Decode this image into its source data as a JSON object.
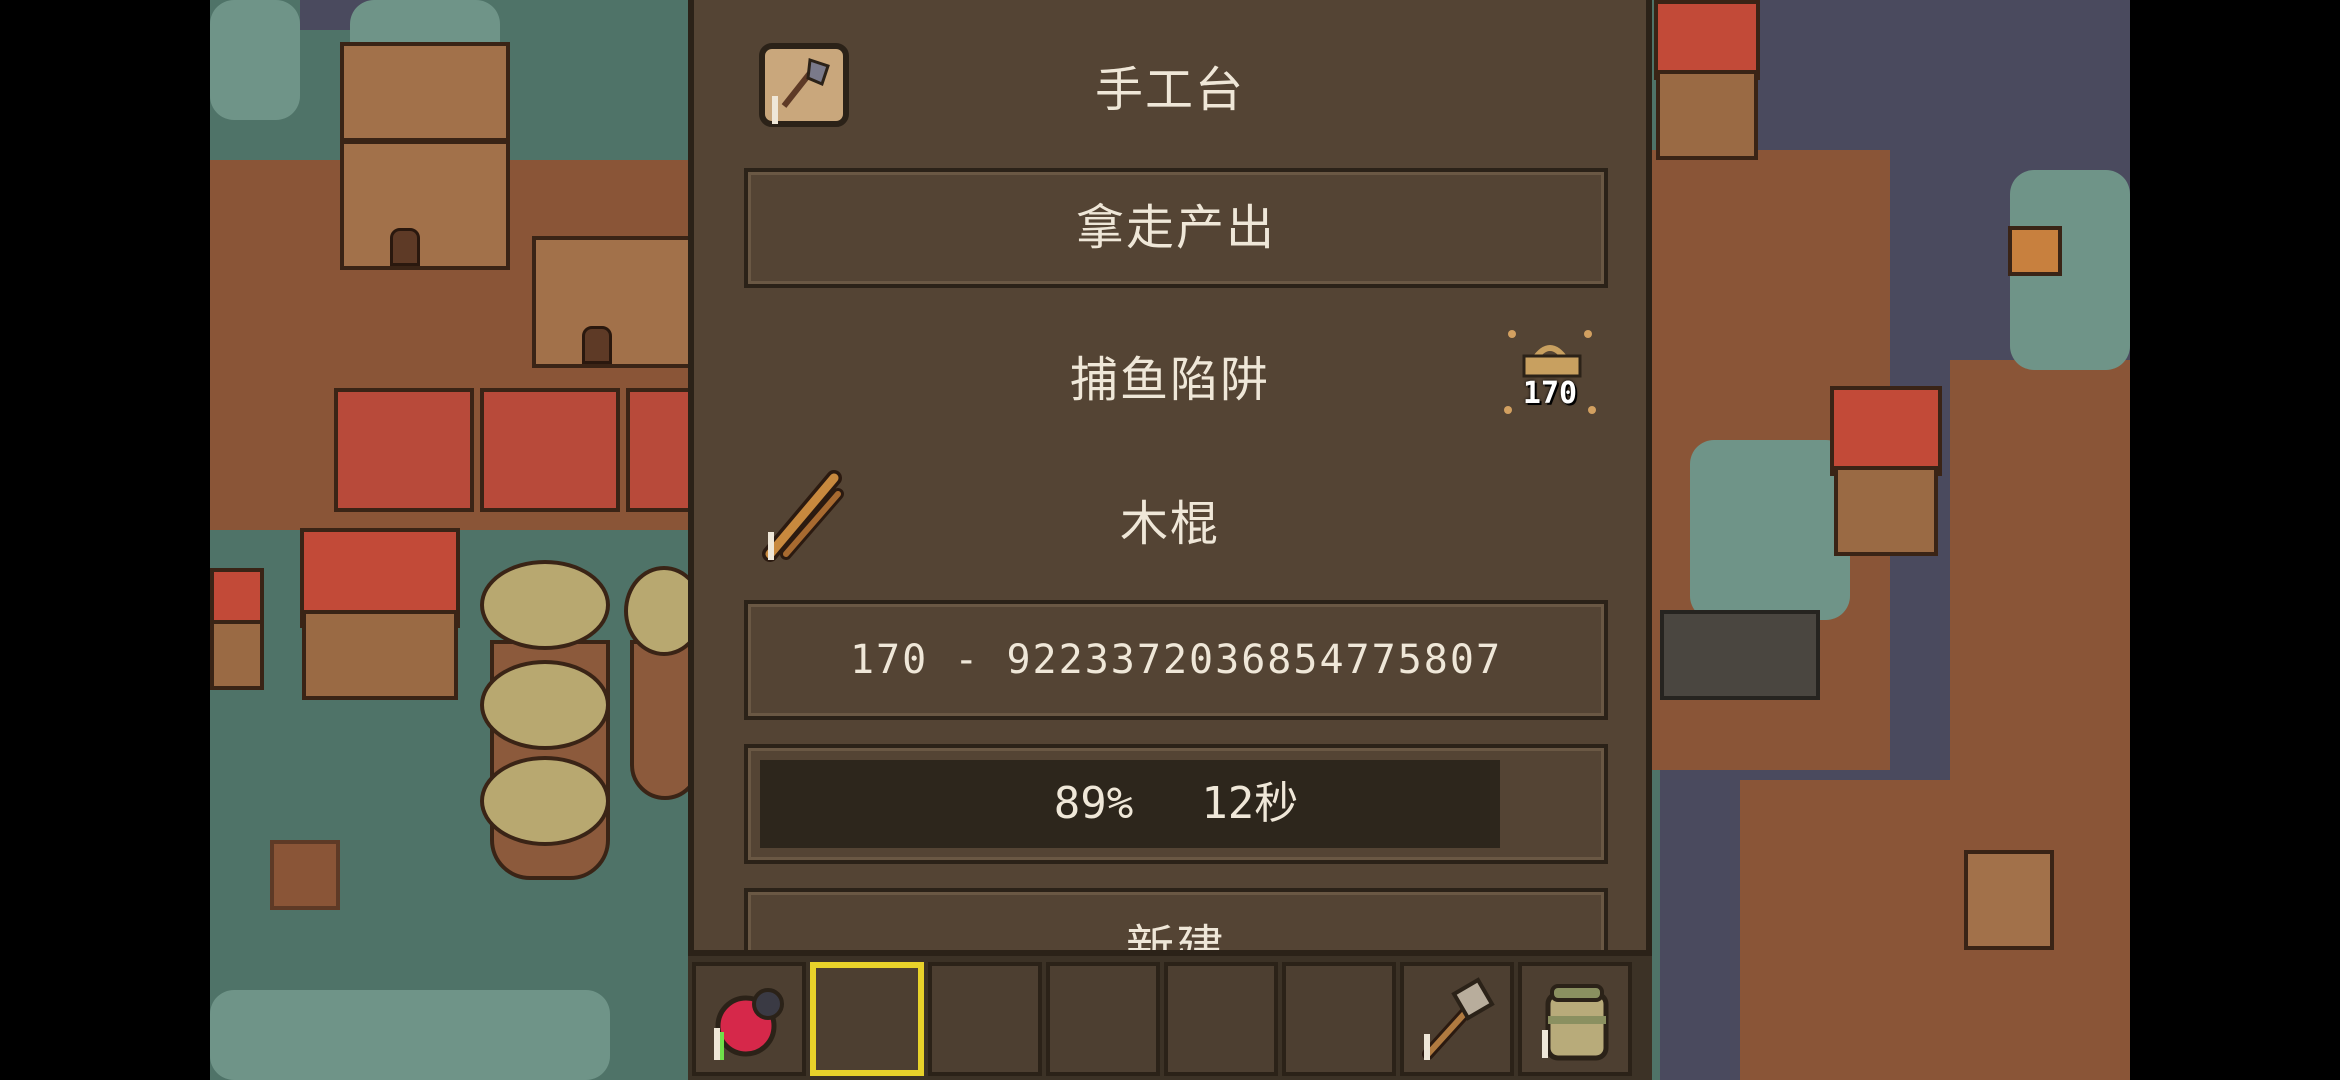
{
  "panel": {
    "title": "手工台",
    "take_output_label": "拿走产出",
    "recipe_name": "捕鱼陷阱",
    "recipe_count_badge": "170",
    "ingredient_name": "木棍",
    "quantity_range": "170 - 9223372036854775807",
    "progress": {
      "percent_text": "89%",
      "time_text": "12秒",
      "fraction": 0.89
    },
    "next_button_label": "新建"
  },
  "hotbar": {
    "slots": [
      {
        "icon": "red-berry-icon"
      },
      {
        "icon": "",
        "selected": true
      },
      {
        "icon": ""
      },
      {
        "icon": ""
      },
      {
        "icon": ""
      },
      {
        "icon": ""
      },
      {
        "icon": "hammer-icon"
      },
      {
        "icon": "backpack-icon"
      }
    ]
  },
  "colors": {
    "panel_bg": "#544434",
    "panel_border": "#2b2218",
    "text": "#efe7d8",
    "selected_slot": "#e8d22a",
    "progress_dark": "#2d261c"
  }
}
